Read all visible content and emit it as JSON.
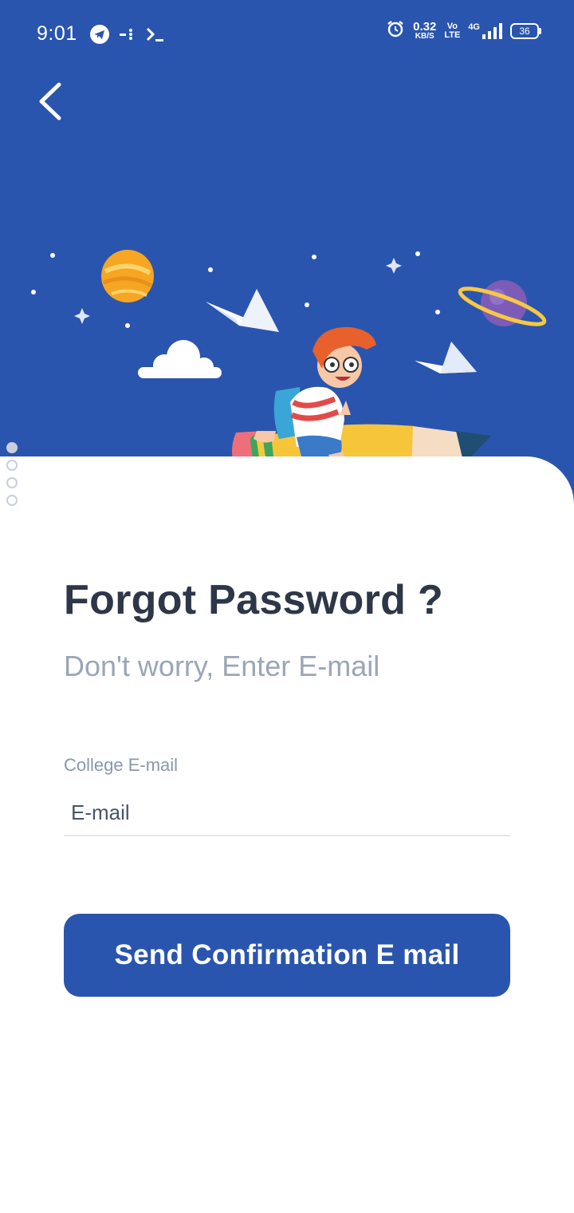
{
  "status_bar": {
    "time": "9:01",
    "speed_value": "0.32",
    "speed_unit": "KB/S",
    "volte_top": "Vo",
    "volte_bottom": "LTE",
    "network": "4G",
    "battery": "36",
    "icons": [
      "telegram-icon",
      "signal-dots-icon",
      "terminal-icon",
      "alarm-icon",
      "cell-signal-icon"
    ]
  },
  "header": {
    "back_icon": "chevron-left-icon"
  },
  "illustration": {
    "subject": "kid riding pencil rocket in space",
    "pencil_number": "2"
  },
  "pager": {
    "count": 4,
    "active_index": 0
  },
  "main": {
    "title": "Forgot Password ?",
    "subtitle": "Don't worry, Enter E-mail",
    "email_label": "College E-mail",
    "email_placeholder": "E-mail",
    "email_value": "",
    "send_button": "Send Confirmation E mail"
  },
  "colors": {
    "primary": "#2A55AE",
    "title": "#2D3748",
    "subtitle": "#9AA6B8",
    "background": "#FFFFFF"
  }
}
